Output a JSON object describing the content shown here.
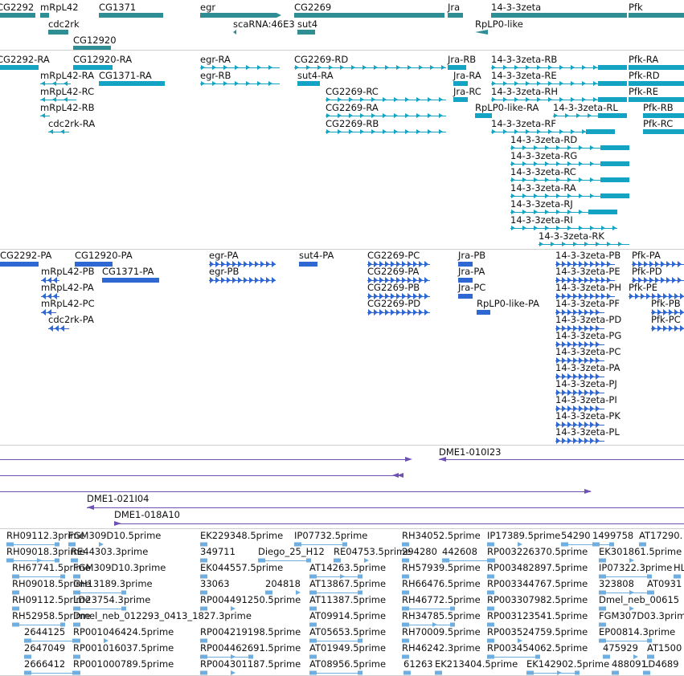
{
  "colors": {
    "gene": "#2f8d94",
    "transcript": "#14a3c3",
    "protein": "#2f67d3",
    "bac": "#6e52b2",
    "est": "#6eaee0",
    "separator": "#cfcfcf"
  },
  "tracks": {
    "genes": [
      {
        "label": "CG2292"
      },
      {
        "label": "mRpL42"
      },
      {
        "label": "CG1371"
      },
      {
        "label": "egr"
      },
      {
        "label": "CG2269"
      },
      {
        "label": "Jra"
      },
      {
        "label": "14-3-3zeta"
      },
      {
        "label": "Pfk"
      },
      {
        "label": "cdc2rk"
      },
      {
        "label": "scaRNA:46E3"
      },
      {
        "label": "sut4"
      },
      {
        "label": "RpLP0-like"
      },
      {
        "label": "CG12920"
      }
    ],
    "transcripts": [
      {
        "label": "CG2292-RA"
      },
      {
        "label": "CG12920-RA"
      },
      {
        "label": "egr-RA"
      },
      {
        "label": "CG2269-RD"
      },
      {
        "label": "Jra-RB"
      },
      {
        "label": "14-3-3zeta-RB"
      },
      {
        "label": "Pfk-RA"
      },
      {
        "label": "mRpL42-RA"
      },
      {
        "label": "CG1371-RA"
      },
      {
        "label": "egr-RB"
      },
      {
        "label": "sut4-RA"
      },
      {
        "label": "Jra-RA"
      },
      {
        "label": "14-3-3zeta-RE"
      },
      {
        "label": "Pfk-RD"
      },
      {
        "label": "mRpL42-RC"
      },
      {
        "label": "CG2269-RC"
      },
      {
        "label": "Jra-RC"
      },
      {
        "label": "14-3-3zeta-RH"
      },
      {
        "label": "Pfk-RE"
      },
      {
        "label": "mRpL42-RB"
      },
      {
        "label": "CG2269-RA"
      },
      {
        "label": "RpLP0-like-RA"
      },
      {
        "label": "14-3-3zeta-RL"
      },
      {
        "label": "Pfk-RB"
      },
      {
        "label": "cdc2rk-RA"
      },
      {
        "label": "CG2269-RB"
      },
      {
        "label": "14-3-3zeta-RF"
      },
      {
        "label": "Pfk-RC"
      },
      {
        "label": "14-3-3zeta-RD"
      },
      {
        "label": "14-3-3zeta-RG"
      },
      {
        "label": "14-3-3zeta-RC"
      },
      {
        "label": "14-3-3zeta-RA"
      },
      {
        "label": "14-3-3zeta-RJ"
      },
      {
        "label": "14-3-3zeta-RI"
      },
      {
        "label": "14-3-3zeta-RK"
      }
    ],
    "proteins": [
      {
        "label": "CG2292-PA"
      },
      {
        "label": "CG12920-PA"
      },
      {
        "label": "egr-PA"
      },
      {
        "label": "sut4-PA"
      },
      {
        "label": "CG2269-PC"
      },
      {
        "label": "Jra-PB"
      },
      {
        "label": "14-3-3zeta-PB"
      },
      {
        "label": "Pfk-PA"
      },
      {
        "label": "mRpL42-PB"
      },
      {
        "label": "CG1371-PA"
      },
      {
        "label": "egr-PB"
      },
      {
        "label": "CG2269-PA"
      },
      {
        "label": "Jra-PA"
      },
      {
        "label": "14-3-3zeta-PE"
      },
      {
        "label": "Pfk-PD"
      },
      {
        "label": "mRpL42-PA"
      },
      {
        "label": "CG2269-PB"
      },
      {
        "label": "Jra-PC"
      },
      {
        "label": "14-3-3zeta-PH"
      },
      {
        "label": "Pfk-PE"
      },
      {
        "label": "mRpL42-PC"
      },
      {
        "label": "CG2269-PD"
      },
      {
        "label": "RpLP0-like-PA"
      },
      {
        "label": "14-3-3zeta-PF"
      },
      {
        "label": "Pfk-PB"
      },
      {
        "label": "cdc2rk-PA"
      },
      {
        "label": "14-3-3zeta-PD"
      },
      {
        "label": "Pfk-PC"
      },
      {
        "label": "14-3-3zeta-PG"
      },
      {
        "label": "14-3-3zeta-PC"
      },
      {
        "label": "14-3-3zeta-PA"
      },
      {
        "label": "14-3-3zeta-PJ"
      },
      {
        "label": "14-3-3zeta-PI"
      },
      {
        "label": "14-3-3zeta-PK"
      },
      {
        "label": "14-3-3zeta-PL"
      }
    ],
    "bacs": [
      {
        "label": "DME1-010I23"
      },
      {
        "label": "DME1-021I04"
      },
      {
        "label": "DME1-018A10"
      }
    ],
    "ests": [
      {
        "label": "RH09112.3prime"
      },
      {
        "label": "FGM309D10.5prime"
      },
      {
        "label": "EK229348.5prime"
      },
      {
        "label": "IP07732.5prime"
      },
      {
        "label": "RH34052.5prime"
      },
      {
        "label": "IP17389.5prime"
      },
      {
        "label": "54290"
      },
      {
        "label": "1499758"
      },
      {
        "label": "AT17290."
      },
      {
        "label": "RH09018.3prime"
      },
      {
        "label": "RE44303.3prime"
      },
      {
        "label": "349711"
      },
      {
        "label": "Diego_25_H12"
      },
      {
        "label": "RE04753.5prime"
      },
      {
        "label": "294280"
      },
      {
        "label": "442608"
      },
      {
        "label": "RP003226370.5prime"
      },
      {
        "label": "EK301861.5prime"
      },
      {
        "label": "RH67741.5prime"
      },
      {
        "label": "FGM309D10.3prime"
      },
      {
        "label": "EK044557.5prime"
      },
      {
        "label": "AT14263.5prime"
      },
      {
        "label": "RH57939.5prime"
      },
      {
        "label": "RP003482897.5prime"
      },
      {
        "label": "IP07322.3prime"
      },
      {
        "label": "HL"
      },
      {
        "label": "RH09018.5prime"
      },
      {
        "label": "GH13189.3prime"
      },
      {
        "label": "33063"
      },
      {
        "label": "204818"
      },
      {
        "label": "AT13867.5prime"
      },
      {
        "label": "RH66476.5prime"
      },
      {
        "label": "RP003344767.5prime"
      },
      {
        "label": "323808"
      },
      {
        "label": "AT0931"
      },
      {
        "label": "RH09112.5prime"
      },
      {
        "label": "LD23754.3prime"
      },
      {
        "label": "RP004491250.5prime"
      },
      {
        "label": "AT11387.5prime"
      },
      {
        "label": "RH46772.5prime"
      },
      {
        "label": "RP003307982.5prime"
      },
      {
        "label": "Dmel_neb_00615"
      },
      {
        "label": "RH52958.5prime"
      },
      {
        "label": "Dmel_neb_012293_0413_1827.3prime"
      },
      {
        "label": "AT09914.5prime"
      },
      {
        "label": "RH34785.5prime"
      },
      {
        "label": "RP003123541.5prime"
      },
      {
        "label": "FGM307D03.3prim"
      },
      {
        "label": "2644125"
      },
      {
        "label": "RP001046424.5prime"
      },
      {
        "label": "RP004219198.5prime"
      },
      {
        "label": "AT05653.5prime"
      },
      {
        "label": "RH70009.5prime"
      },
      {
        "label": "RP003524759.5prime"
      },
      {
        "label": "EP00814.3prime"
      },
      {
        "label": "2647049"
      },
      {
        "label": "RP001016037.5prime"
      },
      {
        "label": "RP004462691.5prime"
      },
      {
        "label": "AT01949.5prime"
      },
      {
        "label": "RH46242.3prime"
      },
      {
        "label": "RP003454062.5prime"
      },
      {
        "label": "475929"
      },
      {
        "label": "AT1500"
      },
      {
        "label": "2666412"
      },
      {
        "label": "RP001000789.5prime"
      },
      {
        "label": "RP004301187.5prime"
      },
      {
        "label": "AT08956.5prime"
      },
      {
        "label": "61263"
      },
      {
        "label": "EK213404.5prime"
      },
      {
        "label": "EK142902.5prime"
      },
      {
        "label": "488091"
      },
      {
        "label": "LD4689"
      }
    ]
  }
}
